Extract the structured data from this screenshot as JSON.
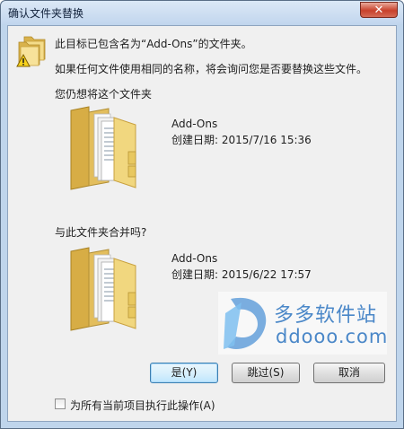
{
  "window": {
    "title": "确认文件夹替换",
    "close_glyph": "✕"
  },
  "message": {
    "line1": "此目标已包含名为“Add-Ons”的文件夹。",
    "line2": "如果任何文件使用相同的名称，将会询问您是否要替换这些文件。",
    "line3": "您仍想将这个文件夹",
    "line4": "与此文件夹合并吗?"
  },
  "existing_folder": {
    "name": "Add-Ons",
    "date": "创建日期: 2015/7/16 15:36"
  },
  "source_folder": {
    "name": "Add-Ons",
    "date": "创建日期: 2015/6/22 17:57"
  },
  "buttons": {
    "yes": "是(Y)",
    "skip": "跳过(S)",
    "cancel": "取消"
  },
  "apply_all": {
    "label": "为所有当前项目执行此操作(A)",
    "checked": false
  },
  "watermark": {
    "cn": "多多软件站",
    "en": "ddooo.com"
  },
  "colors": {
    "title_bar": "#c2d6ee",
    "close_button": "#c8412b",
    "dialog_bg": "#f0f0f0",
    "default_button_border": "#3c7fb1",
    "watermark": "#4a87c8"
  }
}
